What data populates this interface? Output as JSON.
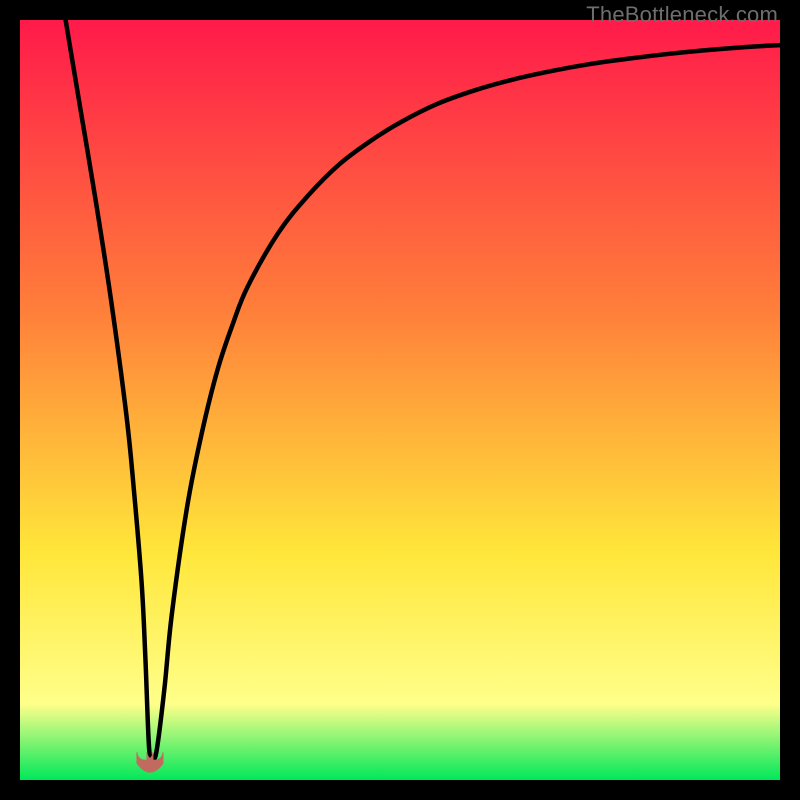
{
  "watermark": "TheBottleneck.com",
  "colors": {
    "gradient_top": "#ff1a4a",
    "gradient_mid1": "#ff7e3a",
    "gradient_mid2": "#ffe63a",
    "gradient_mid3": "#ffff8a",
    "gradient_bottom": "#00e85a",
    "curve": "#000000",
    "marker_fill": "#c06a60",
    "marker_stroke": "#c06a60",
    "frame": "#000000"
  },
  "chart_data": {
    "type": "line",
    "title": "",
    "xlabel": "",
    "ylabel": "",
    "xlim": [
      0,
      100
    ],
    "ylim": [
      0,
      100
    ],
    "grid": false,
    "legend": false,
    "series": [
      {
        "name": "bottleneck-curve",
        "x": [
          6,
          8,
          10,
          12,
          14,
          15,
          16,
          16.5,
          17,
          17.5,
          18,
          19,
          20,
          22,
          24,
          26,
          28,
          30,
          34,
          38,
          42,
          46,
          50,
          55,
          60,
          65,
          70,
          75,
          80,
          85,
          90,
          95,
          100
        ],
        "y": [
          100,
          88,
          76,
          63,
          48,
          38,
          26,
          16,
          4,
          3,
          4,
          12,
          22,
          36,
          46,
          54,
          60,
          65,
          72,
          77,
          81,
          84,
          86.5,
          89,
          90.8,
          92.2,
          93.3,
          94.2,
          94.9,
          95.5,
          96,
          96.4,
          96.7
        ]
      }
    ],
    "marker": {
      "x": 17.1,
      "y": 2.2
    }
  }
}
